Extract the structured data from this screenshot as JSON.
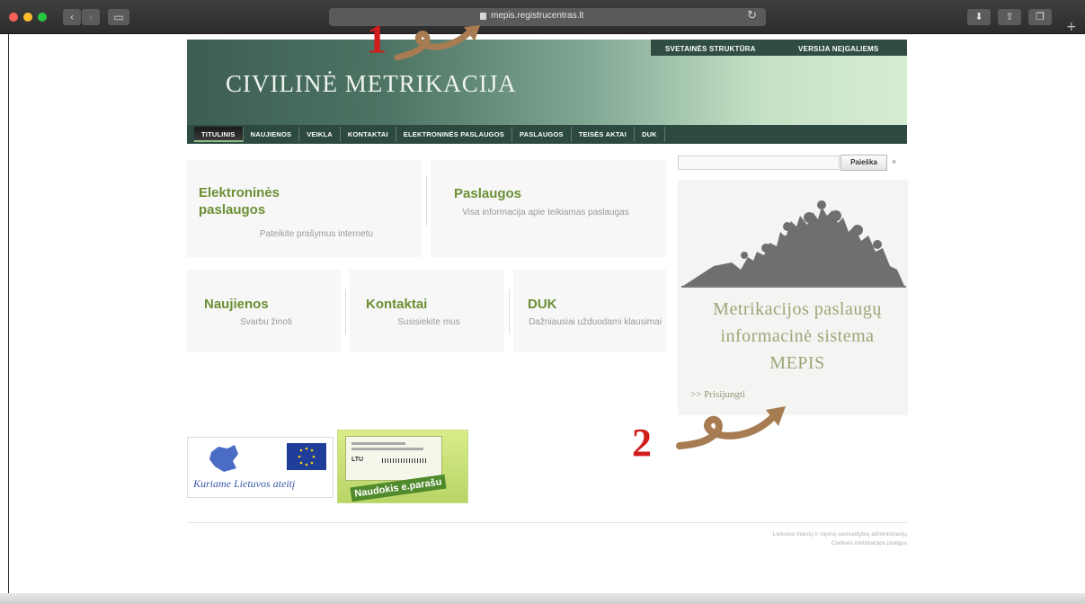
{
  "browser": {
    "url": "mepis.registrucentras.lt"
  },
  "header": {
    "site_title": "CIVILINĖ METRIKACIJA",
    "top_links": [
      "SVETAINĖS STRUKTŪRA",
      "VERSIJA NEĮGALIEMS"
    ]
  },
  "nav": {
    "items": [
      "TITULINIS",
      "NAUJIENOS",
      "VEIKLA",
      "KONTAKTAI",
      "ELEKTRONINĖS PASLAUGOS",
      "PASLAUGOS",
      "TEISĖS AKTAI",
      "DUK"
    ]
  },
  "search": {
    "placeholder": "",
    "button_label": "Paieška",
    "clear_label": "×"
  },
  "tiles": [
    {
      "title": "Elektroninės paslaugos",
      "desc": "Pateikite prašymus internetu"
    },
    {
      "title": "Paslaugos",
      "desc": "Visa informacija apie teikiamas paslaugas"
    },
    {
      "title": "Naujienos",
      "desc": "Svarbu žinoti"
    },
    {
      "title": "Kontaktai",
      "desc": "Susisiekite mus"
    },
    {
      "title": "DUK",
      "desc": "Dažniausiai užduodami klausimai"
    }
  ],
  "mepis": {
    "title_line1": "Metrikacijos paslaugų",
    "title_line2": "informacinė sistema",
    "title_line3": "MEPIS",
    "login_label": ">> Prisijungti"
  },
  "logos": {
    "eu_slogan": "Kuriame Lietuvos ateitį",
    "esign_text": "Naudokis e.parašu",
    "card_country": "LTU"
  },
  "footer": {
    "line1": "Lietuvos miestų ir rajonų savivaldybių administracijų",
    "line2": "Civilinės metrikacijos įstaigos"
  },
  "annotations": {
    "label_1": "1",
    "label_2": "2"
  },
  "colors": {
    "accent_green": "#6c8f34",
    "nav_dark": "#2c4a40",
    "annotation_red": "#d21c1c",
    "annotation_arrow": "#a77c52"
  }
}
